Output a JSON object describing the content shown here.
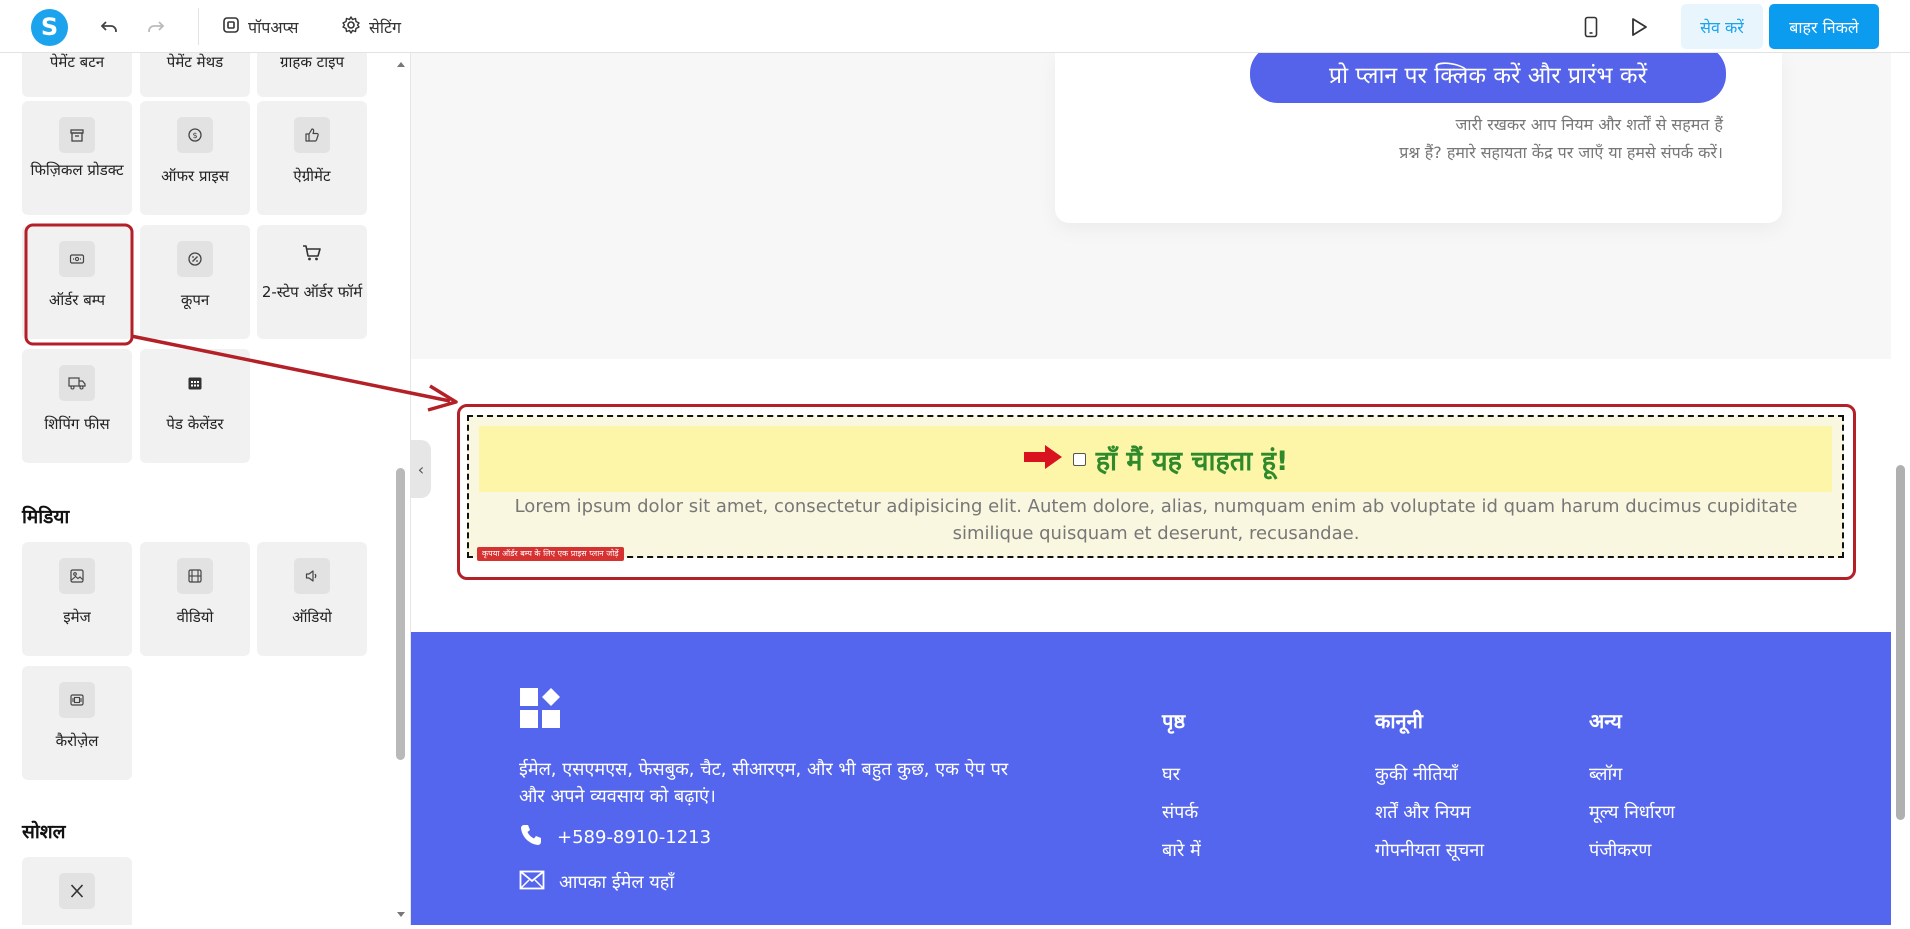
{
  "topbar": {
    "popups_label": "पॉपअप्स",
    "settings_label": "सेटिंग",
    "save_label": "सेव करें",
    "exit_label": "बाहर निकले"
  },
  "sidebar": {
    "row0": [
      "पेमेंट बटन",
      "पेमेंट मेथड",
      "ग्राहक टाइप"
    ],
    "physical_product": "फिज़िकल प्रोडक्ट",
    "offer_price": "ऑफर प्राइस",
    "agreement": "ऐग्रीमेंट",
    "order_bump": "ऑर्डर बम्प",
    "coupon": "कूपन",
    "two_step": "2-स्टेप ऑर्डर फॉर्म",
    "shipping_fee": "शिपिंग फीस",
    "paid_calendar": "पेड केलेंडर",
    "media_title": "मिडिया",
    "image": "इमेज",
    "video": "वीडियो",
    "audio": "ऑडियो",
    "carousel": "कैरोज़ेल",
    "social_title": "सोशल"
  },
  "canvas": {
    "pro_button": "प्रो प्लान पर क्लिक करें और प्रारंभ करें",
    "terms_line1": "जारी रखकर आप नियम और शर्तों से सहमत हैं",
    "terms_line2": "प्रश्न हैं? हमारे सहायता केंद्र पर जाएँ या हमसे संपर्क करें।",
    "bump_title": "हाँ मैं यह चाहता हूं!",
    "bump_desc": "Lorem ipsum dolor sit amet, consectetur adipisicing elit. Autem dolore, alias, numquam enim ab voluptate id quam harum ducimus cupiditate similique quisquam et deserunt, recusandae.",
    "bump_tag": "कृपया ऑर्डर बम्प के लिए एक प्राइस प्लान जोड़ें"
  },
  "footer": {
    "description": "ईमेल, एसएमएस, फेसबुक, चैट, सीआरएम, और भी बहुत कुछ, एक ऐप पर और अपने व्यवसाय को बढ़ाएं।",
    "phone": "+589-8910-1213",
    "email": "आपका ईमेल यहाँ",
    "col1_title": "पृष्ठ",
    "col1_items": [
      "घर",
      "संपर्क",
      "बारे में"
    ],
    "col2_title": "कानूनी",
    "col2_items": [
      "कुकी नीतियाँ",
      "शर्तें और नियम",
      "गोपनीयता सूचना"
    ],
    "col3_title": "अन्य",
    "col3_items": [
      "ब्लॉग",
      "मूल्य निर्धारण",
      "पंजीकरण"
    ]
  },
  "colors": {
    "brand": "#1ba3ee",
    "footer_bg": "#5566ee",
    "annotation_red": "#b42027",
    "bump_title_green": "#2f8a2c"
  }
}
